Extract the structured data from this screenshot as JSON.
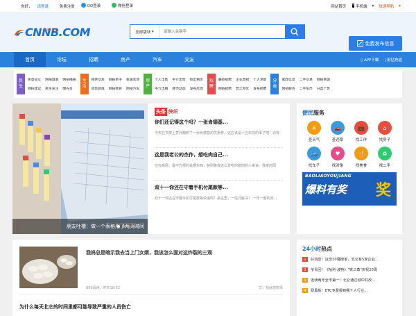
{
  "topbar": {
    "greeting": "你好，",
    "login": "请登录",
    "register": "免费注册",
    "qq_login": "QQ登录",
    "wechat_login": "微信登录",
    "home": "网站首页",
    "mobile": "手机端",
    "quick_nav": "快速导航"
  },
  "header": {
    "logo_text": "CNNB.COM",
    "logo_sub": "宁波东方网",
    "search_select": "全部版块",
    "search_placeholder": "请输入关键字",
    "publish_btn": "免费发布信息"
  },
  "nav": {
    "items": [
      "首页",
      "论坛",
      "招聘",
      "房产",
      "汽车",
      "交友"
    ],
    "app": "APP下载",
    "recharge": "用钻充值"
  },
  "categories": [
    {
      "tag": [
        "民",
        "生"
      ],
      "color": "#7b5fc4",
      "links": [
        "民意征众",
        "网拍城事",
        "网拍播报",
        "网拍建议",
        "民生关注",
        "曝光台"
      ]
    },
    {
      "tag": [
        "生",
        "活"
      ],
      "color": "#ee6c1b",
      "links": [
        "相亲交友",
        "网拍亲子",
        "家居装饰",
        "装装颜值",
        "网拍教育",
        "网拍汽车"
      ]
    },
    {
      "tag": [
        "房",
        "产"
      ],
      "color": "#4db33d",
      "links": [
        "个人出售",
        "中介出售",
        "找出租房",
        "中介出租",
        "楼市动态",
        "发布房源"
      ]
    },
    {
      "tag": [
        "招",
        "聘"
      ],
      "color": "#e64a4a",
      "links": [
        "最新招聘",
        "企业直招",
        "个人求职",
        "网拍招聘",
        "普工专区",
        "发布招聘"
      ]
    },
    {
      "tag": [
        "分",
        "类"
      ],
      "color": "#2b82dd",
      "links": [
        "家政信息",
        "二手交易",
        "网拍商城",
        "网拍服务",
        "二手车市",
        "分类广告"
      ]
    }
  ],
  "feature": {
    "caption": "朋友吐槽：做一个表格用了两天时间",
    "toutiao_a": "头条",
    "toutiao_b": "快讯",
    "news": [
      {
        "title": "你们还记得这个吗？一张肯德基...",
        "desc": "今天在书架上意外翻到了一张肯德基的优惠券，这应该是十五年前的事了吧！记得"
      },
      {
        "title": "这是我老公的杰作，想吃肉自己...",
        "desc": "住在高层，最不方便的是晒东西，特别像我这么爱吃的腊肉的人来说。我家的阳"
      },
      {
        "title": "双十一你还在守着手机付尾款等...",
        "desc": "双十一你还在守着手机付尾款等快递吗？来这里，一站式解决！ 一年一度的双..."
      }
    ]
  },
  "list": {
    "title": "我妈总是暗示我去当上门女婿，我该怎么面对这炸裂的三观",
    "meta": "899阅读，昨天18:52",
    "author": "文 / 我就想搞事",
    "next": "为什么每天北仑的时间里都可能导致严重的人员伤亡"
  },
  "services": {
    "title_a": "便民",
    "title_b": "服务",
    "items": [
      {
        "label": "查天气",
        "color": "#f39c12",
        "icon": "☀"
      },
      {
        "label": "查违章",
        "color": "#3a9bdc",
        "icon": "🚗"
      },
      {
        "label": "找工作",
        "color": "#e74c3c",
        "icon": "💼"
      },
      {
        "label": "找房子",
        "color": "#e74c3c",
        "icon": "⌂"
      },
      {
        "label": "找车子",
        "color": "#3a9bdc",
        "icon": "🚙"
      },
      {
        "label": "找对象",
        "color": "#e74c8a",
        "icon": "♥"
      },
      {
        "label": "找美食",
        "color": "#f39c12",
        "icon": "🍴"
      },
      {
        "label": "找二手",
        "color": "#2ecc71",
        "icon": "♻"
      }
    ]
  },
  "banner": {
    "en": "BAOLIAOYOUJIANG",
    "cn": "爆料有奖",
    "prize": "奖"
  },
  "hot": {
    "title_a": "24小时",
    "title_b": "热点",
    "items": [
      {
        "n": "1",
        "color": "#e74c3c",
        "text": "好消息！这份20强榜单，北仑有5家企业..."
      },
      {
        "n": "2",
        "color": "#e74c3c",
        "text": "爷青回！《哈利·波特》\"铁三角\"庆祝20周"
      },
      {
        "n": "3",
        "color": "#f39c12",
        "text": "连续两年全市第一！北仑通过城中村改..."
      },
      {
        "n": "4",
        "color": "#f39c12",
        "text": "耐黑板！ETC专费报到哪个人行业..."
      }
    ]
  }
}
